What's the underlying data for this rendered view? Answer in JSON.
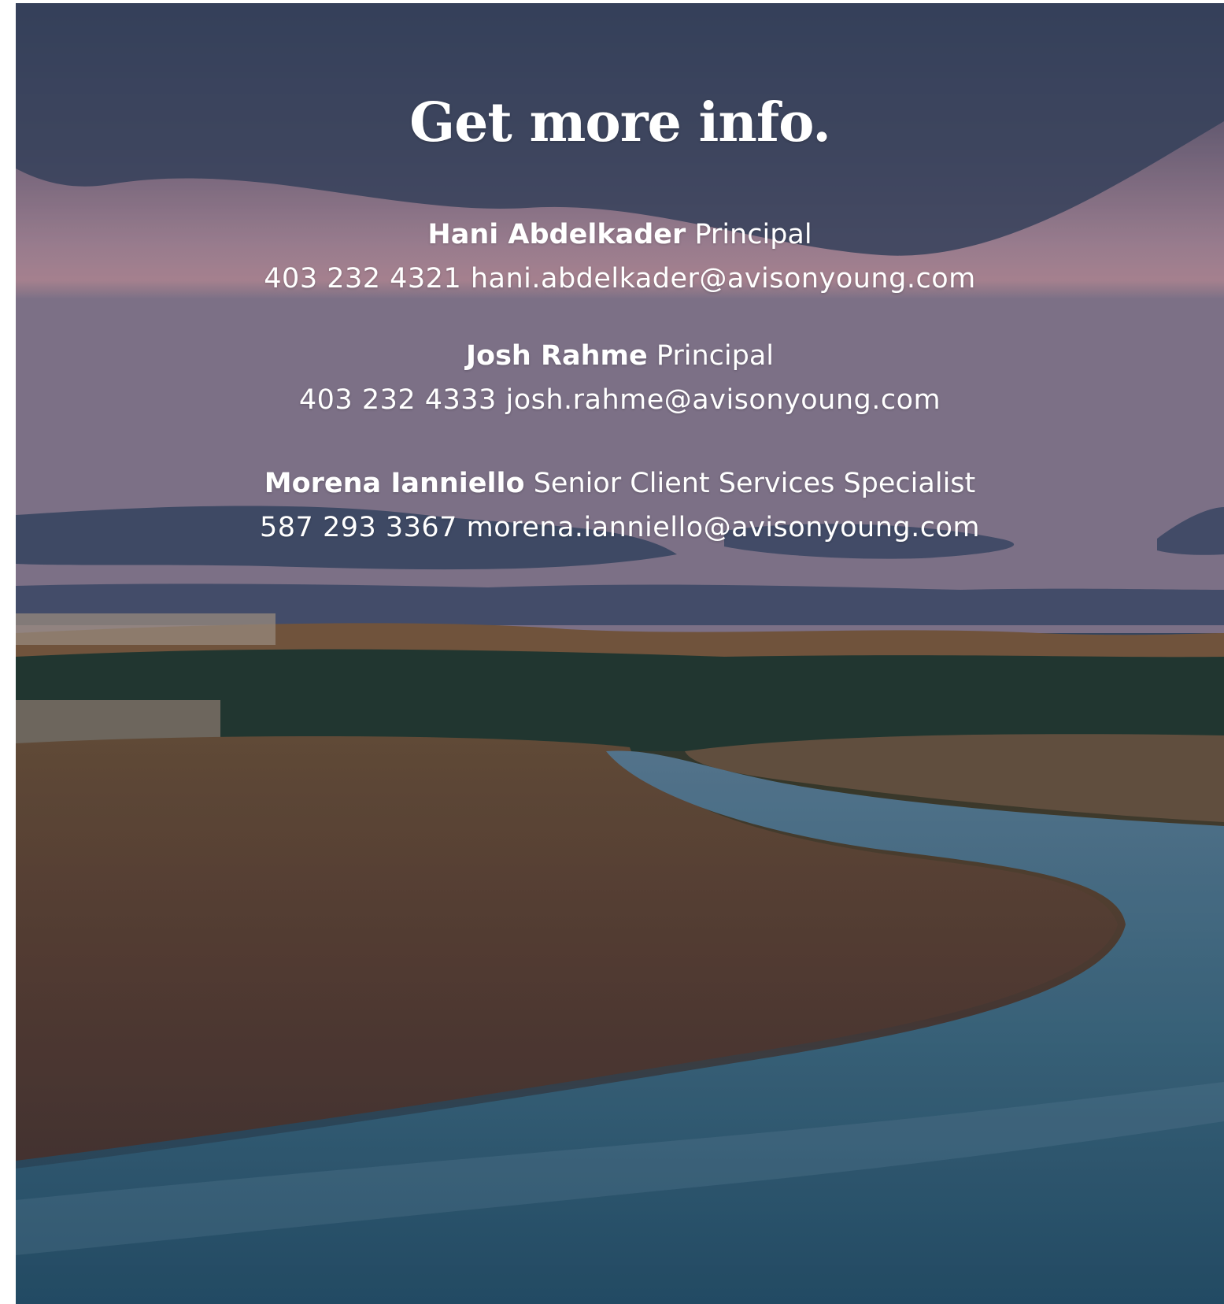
{
  "heading": "Get more info.",
  "contacts": [
    {
      "name": "Hani Abdelkader",
      "role": "Principal",
      "phone": "403 232 4321",
      "email": "hani.abdelkader@avisonyoung.com"
    },
    {
      "name": "Josh Rahme",
      "role": "Principal",
      "phone": "403 232 4333",
      "email": "josh.rahme@avisonyoung.com"
    },
    {
      "name": "Morena Ianniello",
      "role": "Senior Client Services Specialist",
      "phone": "587 293 3367",
      "email": "morena.ianniello@avisonyoung.com"
    }
  ],
  "colors": {
    "text": "#ffffff",
    "sky_top": "#3e4760",
    "sky_pink": "#b48b98",
    "forest": "#2b3b35",
    "river": "#2c5468"
  }
}
